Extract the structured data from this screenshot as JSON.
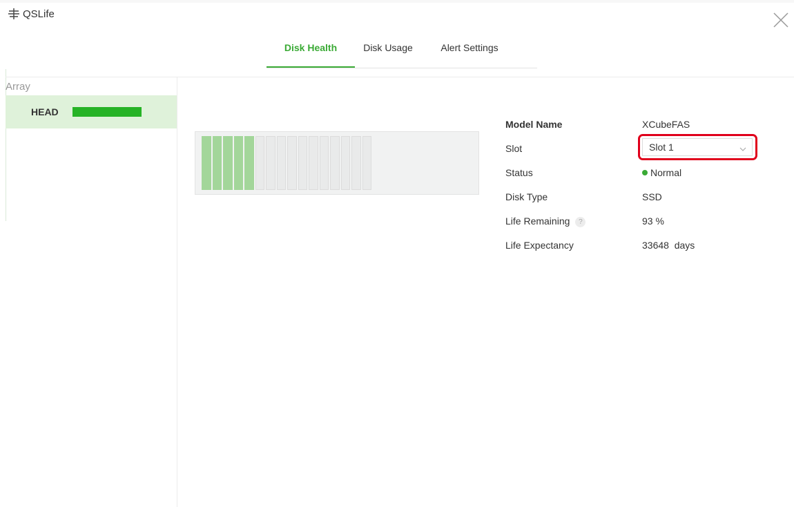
{
  "app": {
    "title": "QSLife",
    "icon": "qslife-logo-icon",
    "close_icon": "close-icon"
  },
  "tabs": [
    {
      "label": "Disk Health",
      "active": true
    },
    {
      "label": "Disk Usage",
      "active": false
    },
    {
      "label": "Alert Settings",
      "active": false
    }
  ],
  "sidebar": {
    "heading": "Array",
    "items": [
      {
        "label": "HEAD",
        "health_fraction": 1.0,
        "selected": true
      }
    ]
  },
  "enclosure": {
    "slots": [
      {
        "slot": 1,
        "occupied": true
      },
      {
        "slot": 2,
        "occupied": true
      },
      {
        "slot": 3,
        "occupied": true
      },
      {
        "slot": 4,
        "occupied": true
      },
      {
        "slot": 5,
        "occupied": true
      },
      {
        "slot": 6,
        "occupied": false
      },
      {
        "slot": 7,
        "occupied": false
      },
      {
        "slot": 8,
        "occupied": false
      },
      {
        "slot": 9,
        "occupied": false
      },
      {
        "slot": 10,
        "occupied": false
      },
      {
        "slot": 11,
        "occupied": false
      },
      {
        "slot": 12,
        "occupied": false
      },
      {
        "slot": 13,
        "occupied": false
      },
      {
        "slot": 14,
        "occupied": false
      },
      {
        "slot": 15,
        "occupied": false
      },
      {
        "slot": 16,
        "occupied": false
      }
    ]
  },
  "details": {
    "model_name_label": "Model Name",
    "model_name_value": "XCubeFAS",
    "slot_label": "Slot",
    "slot_value": "Slot 1",
    "status_label": "Status",
    "status_value": "Normal",
    "disk_type_label": "Disk Type",
    "disk_type_value": "SSD",
    "life_remaining_label": "Life Remaining",
    "life_remaining_help": "?",
    "life_remaining_value": "93 %",
    "life_expectancy_label": "Life Expectancy",
    "life_expectancy_value": "33648  days"
  },
  "colors": {
    "accent": "#3aaa35",
    "selected_bg": "#dff2da",
    "health_fill": "#26b326",
    "occupied_slot": "#a3d69a",
    "highlight": "#e0001b"
  }
}
